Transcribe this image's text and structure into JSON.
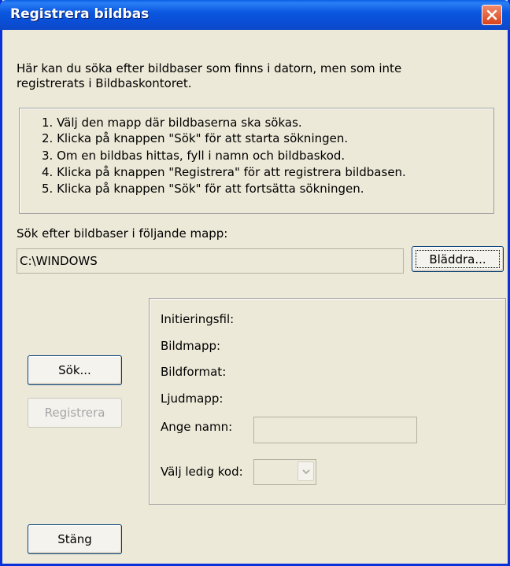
{
  "window": {
    "title": "Registrera bildbas"
  },
  "intro": {
    "line1": "Här kan du söka efter bildbaser som finns i datorn, men som inte",
    "line2": "registrerats i Bildbaskontoret."
  },
  "steps": [
    "1. Välj den mapp där bildbaserna ska sökas.",
    "2. Klicka på knappen \"Sök\" för att starta sökningen.",
    "3. Om en bildbas hittas, fyll i namn och bildbaskod.",
    "4. Klicka på knappen \"Registrera\" för att registrera bildbasen.",
    "5. Klicka på knappen \"Sök\" för att fortsätta sökningen."
  ],
  "folder": {
    "label": "Sök efter bildbaser i följande mapp:",
    "path": "C:\\WINDOWS",
    "browse_label": "Bläddra..."
  },
  "buttons": {
    "search": "Sök...",
    "register": "Registrera",
    "close": "Stäng"
  },
  "info": {
    "init_file": "Initieringsfil:",
    "image_folder": "Bildmapp:",
    "image_format": "Bildformat:",
    "sound_folder": "Ljudmapp:",
    "name_label": "Ange namn:",
    "name_value": "",
    "code_label": "Välj ledig kod:",
    "code_value": ""
  },
  "colors": {
    "titlebar": "#0b58e0",
    "dialog_bg": "#ece9d8",
    "close_button": "#d8431c"
  }
}
